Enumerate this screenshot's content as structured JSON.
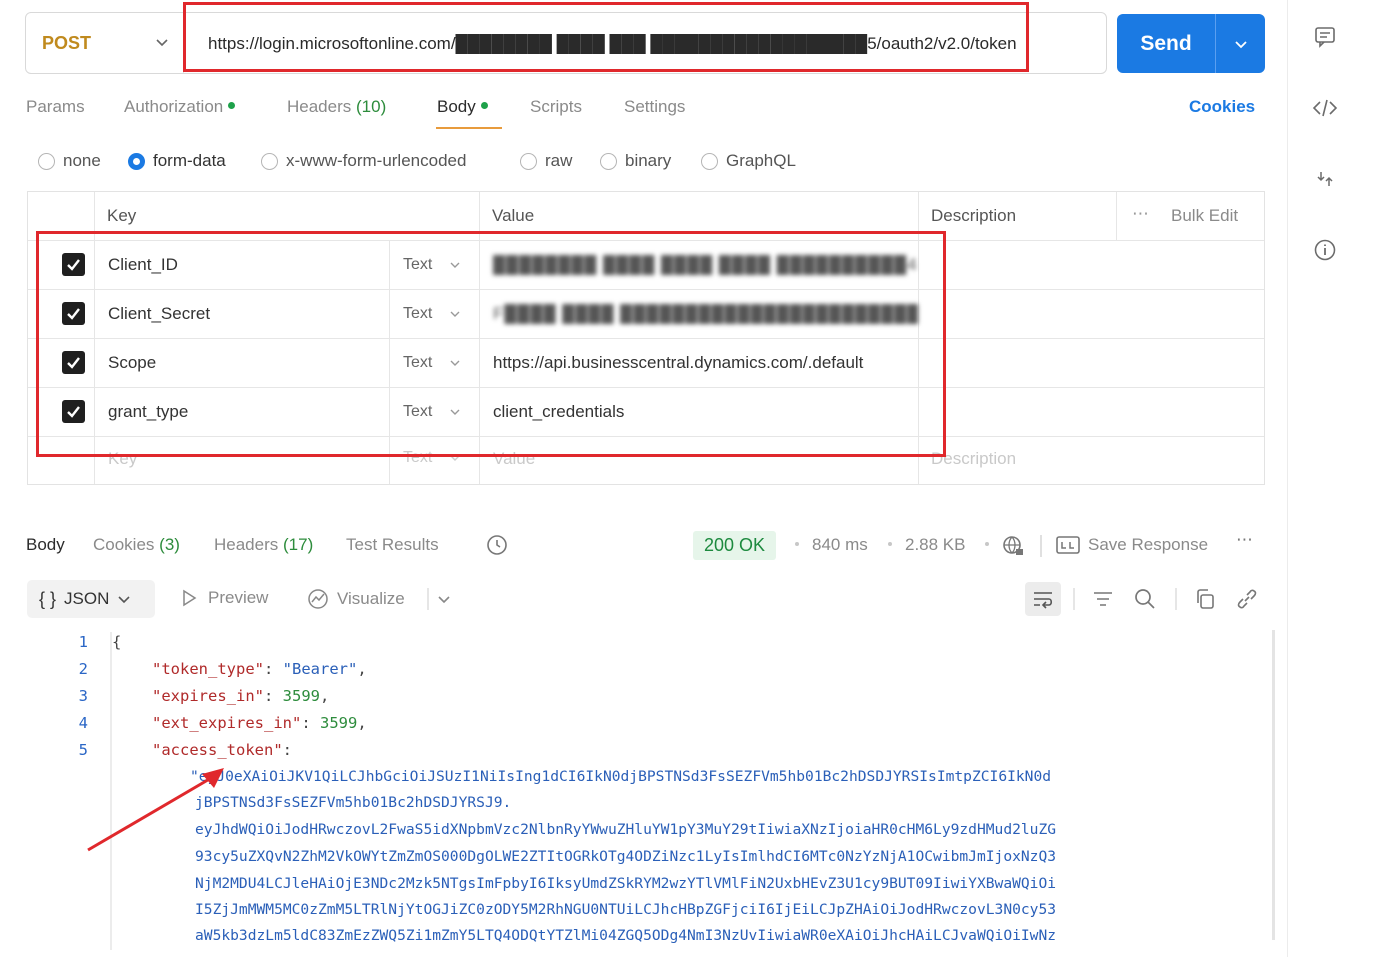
{
  "request": {
    "method": "POST",
    "url": "https://login.microsoftonline.com/████████ ████ ███ ██████████████████5/oauth2/v2.0/token",
    "send_label": "Send"
  },
  "request_tabs": {
    "params": "Params",
    "authorization": "Authorization",
    "headers": "Headers",
    "headers_count": "(10)",
    "body": "Body",
    "scripts": "Scripts",
    "settings": "Settings",
    "cookies": "Cookies"
  },
  "body_types": [
    "none",
    "form-data",
    "x-www-form-urlencoded",
    "raw",
    "binary",
    "GraphQL"
  ],
  "params_table": {
    "headers": {
      "key": "Key",
      "value": "Value",
      "description": "Description",
      "bulk_edit": "Bulk Edit"
    },
    "rows": [
      {
        "checked": true,
        "key": "Client_ID",
        "type": "Text",
        "value": "████████ ████ ████ ████ ██████████455"
      },
      {
        "checked": true,
        "key": "Client_Secret",
        "type": "Text",
        "value": "F████ ████ ███████████████████████BS..."
      },
      {
        "checked": true,
        "key": "Scope",
        "type": "Text",
        "value": "https://api.businesscentral.dynamics.com/.default"
      },
      {
        "checked": true,
        "key": "grant_type",
        "type": "Text",
        "value": "client_credentials"
      }
    ],
    "placeholder": {
      "key": "Key",
      "type": "Text",
      "value": "Value",
      "description": "Description"
    }
  },
  "response": {
    "tabs": {
      "body": "Body",
      "cookies": "Cookies",
      "cookies_count": "(3)",
      "headers": "Headers",
      "headers_count": "(17)",
      "test_results": "Test Results"
    },
    "status": "200 OK",
    "time": "840 ms",
    "size": "2.88 KB",
    "save_response": "Save Response",
    "format": "JSON",
    "preview": "Preview",
    "visualize": "Visualize",
    "line_numbers": [
      "1",
      "2",
      "3",
      "4",
      "5"
    ],
    "json": {
      "open_brace": "{",
      "token_type_key": "\"token_type\"",
      "token_type_value": "\"Bearer\"",
      "expires_in_key": "\"expires_in\"",
      "expires_in_value": "3599",
      "ext_expires_in_key": "\"ext_expires_in\"",
      "ext_expires_in_value": "3599",
      "access_token_key": "\"access_token\"",
      "access_token_lines": [
        "\"eyJ0eXAiOiJKV1QiLCJhbGciOiJSUzI1NiIsIng1dCI6IkN0djBPSTNSd3FsSEZFVm5hb01Bc2hDSDJYRSIsImtpZCI6IkN0d",
        "jBPSTNSd3FsSEZFVm5hb01Bc2hDSDJYRSJ9.",
        "eyJhdWQiOiJodHRwczovL2FwaS5idXNpbmVzc2NlbnRyYWwuZHluYW1pY3MuY29tIiwiaXNzIjoiaHR0cHM6Ly9zdHMud2luZG",
        "93cy5uZXQvN2ZhM2VkOWYtZmZmOS000DgOLWE2ZTItOGRkOTg4ODZiNzc1LyIsImlhdCI6MTc0NzYzNjA1OCwibmJmIjoxNzQ3",
        "NjM2MDU4LCJleHAiOjE3NDc2Mzk5NTgsImFpbyI6IksyUmdZSkRYM2wzYTlVMlFiN2UxbHEvZ3U1cy9BUT09IiwiYXBwaWQiOi",
        "I5ZjJmMWM5MC0zZmM5LTRlNjYtOGJiZC0zODY5M2RhNGU0NTUiLCJhcHBpZGFjciI6IjEiLCJpZHAiOiJodHRwczovL3N0cy53",
        "aW5kb3dzLm5ldC83ZmEzZWQ5Zi1mZmY5LTQ4ODQtYTZlMi04ZGQ5ODg4NmI3NzUvIiwiaWR0eXAiOiJhcHAiLCJvaWQiOiIwNz"
      ]
    }
  }
}
